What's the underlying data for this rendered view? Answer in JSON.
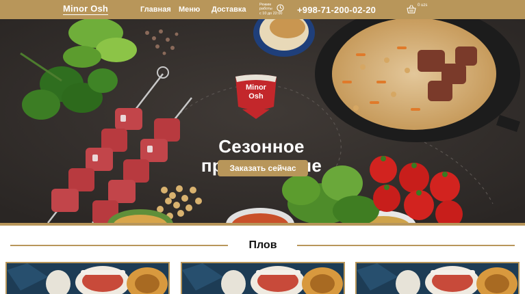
{
  "header": {
    "logo": "Minor Osh",
    "nav": [
      "Главная",
      "Меню",
      "Доставка"
    ],
    "hours_lines": [
      "Режим",
      "работы",
      "с 10 до 22:00"
    ],
    "phone": "+998-71-200-02-20",
    "cart": "0 uzs"
  },
  "hero": {
    "badge_line1": "Minor",
    "badge_line2": "Osh",
    "title_line1": "Сезонное",
    "title_line2": "предложение",
    "button": "Заказать сейчас"
  },
  "section": {
    "title": "Плов"
  },
  "colors": {
    "accent": "#b8965a",
    "hero_bg": "#37322f",
    "badge_red": "#c3272b"
  }
}
